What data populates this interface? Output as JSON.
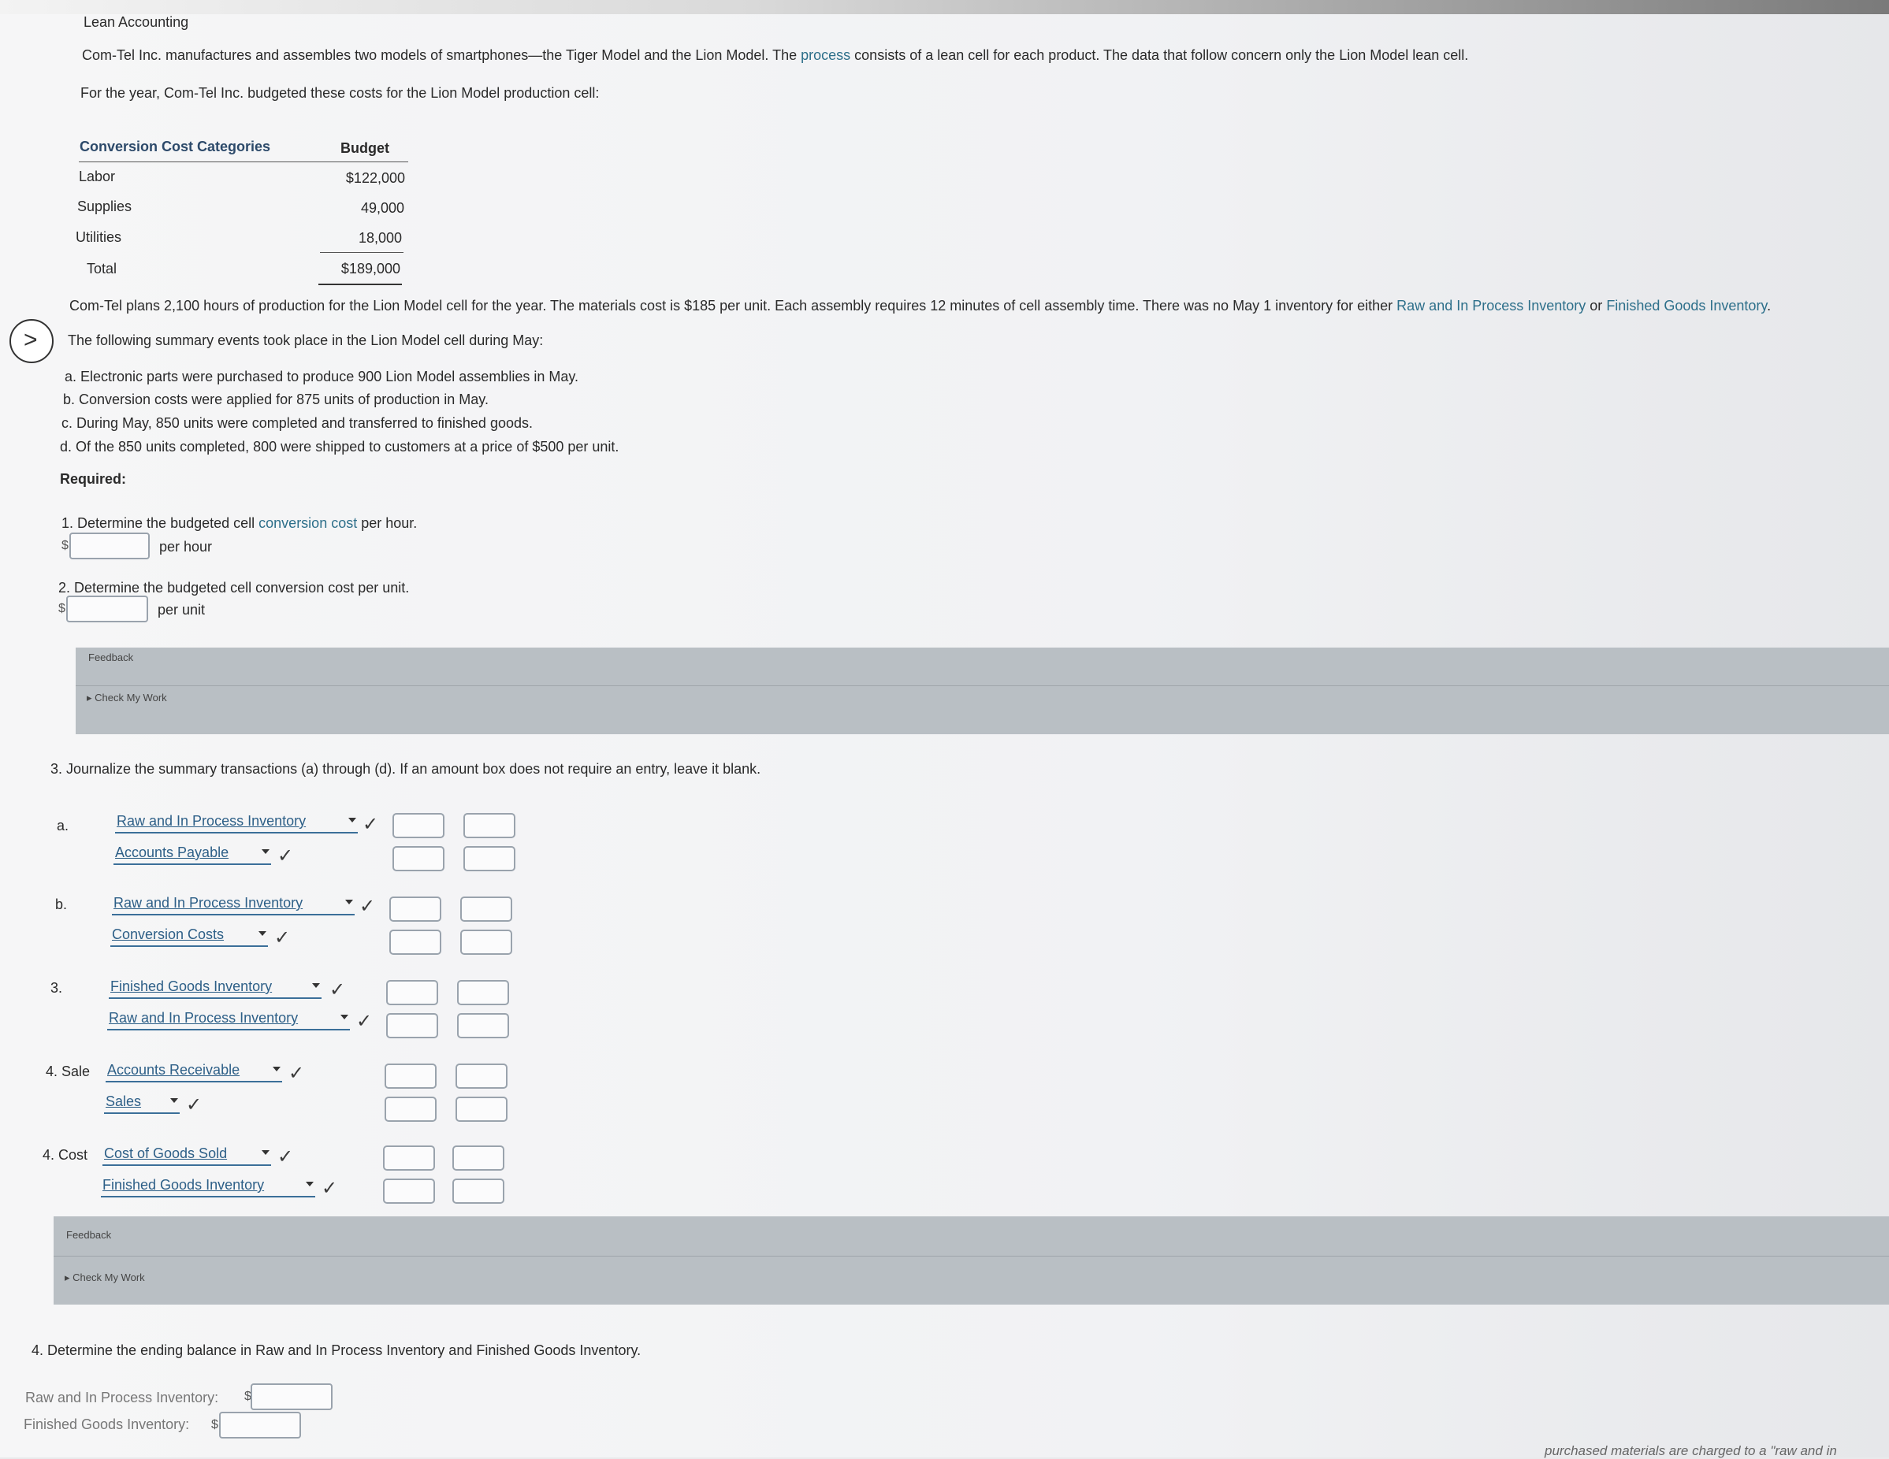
{
  "header": {
    "title": "Lean Accounting",
    "intro_1_pre": "Com-Tel Inc. manufactures and assembles two models of smartphones—the Tiger Model and the Lion Model. The ",
    "intro_1_link": "process",
    "intro_1_post": " consists of a lean cell for each product. The data that follow concern only the Lion Model lean cell.",
    "intro_2": "For the year, Com-Tel Inc. budgeted these costs for the Lion Model production cell:"
  },
  "budget_table": {
    "col1_header": "Conversion Cost Categories",
    "col2_header": "Budget",
    "rows": [
      {
        "label": "Labor",
        "value": "$122,000"
      },
      {
        "label": "Supplies",
        "value": "49,000"
      },
      {
        "label": "Utilities",
        "value": "18,000"
      }
    ],
    "total_label": "Total",
    "total_value": "$189,000"
  },
  "plans": {
    "text_pre": "Com-Tel plans 2,100 hours of production for the Lion Model cell for the year. The materials cost is $185 per unit. Each assembly requires 12 minutes of cell assembly time. There was no May 1 inventory for either ",
    "link_1": "Raw and In Process Inventory",
    "text_mid": " or ",
    "link_2": "Finished Goods Inventory",
    "text_end": ".",
    "summary_intro": "The following summary events took place in the Lion Model cell during May:"
  },
  "events": [
    "a. Electronic parts were purchased to produce 900 Lion Model assemblies in May.",
    "b. Conversion costs were applied for 875 units of production in May.",
    "c. During May, 850 units were completed and transferred to finished goods.",
    "d. Of the 850 units completed, 800 were shipped to customers at a price of $500 per unit."
  ],
  "required_label": "Required:",
  "q1": {
    "pre": "1. Determine the budgeted cell ",
    "link": "conversion cost",
    "post": " per hour.",
    "currency": "$",
    "unit": "per hour"
  },
  "q2": {
    "text": "2. Determine the budgeted cell conversion cost per unit.",
    "currency": "$",
    "unit": "per unit"
  },
  "feedback1": {
    "title": "Feedback",
    "check": "Check My Work"
  },
  "q3": {
    "text": "3. Journalize the summary transactions (a) through (d). If an amount box does not require an entry, leave it blank.",
    "entries": [
      {
        "label": "a.",
        "debit": "Raw and In Process Inventory",
        "credit": "Accounts Payable"
      },
      {
        "label": "b.",
        "debit": "Raw and In Process Inventory",
        "credit": "Conversion Costs"
      },
      {
        "label": "3.",
        "debit": "Finished Goods Inventory",
        "credit": "Raw and In Process Inventory"
      },
      {
        "label": "4. Sale",
        "debit": "Accounts Receivable",
        "credit": "Sales"
      },
      {
        "label": "4. Cost",
        "debit": "Cost of Goods Sold",
        "credit": "Finished Goods Inventory"
      }
    ],
    "check_glyph": "✓"
  },
  "feedback2": {
    "title": "Feedback",
    "check": "Check My Work"
  },
  "q4": {
    "text": "4. Determine the ending balance in Raw and In Process Inventory and Finished Goods Inventory.",
    "raw_label": "Raw and In Process Inventory:",
    "fg_label": "Finished Goods Inventory:",
    "currency": "$"
  },
  "footer_fragment": "purchased materials are charged to a \"raw and in"
}
